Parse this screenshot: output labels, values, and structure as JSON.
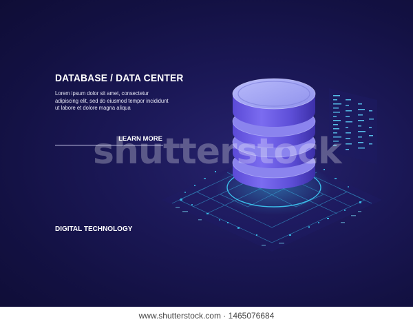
{
  "banner": {
    "headline": "DATABASE / DATA CENTER",
    "body": "Lorem ipsum dolor sit amet, consectetur adipiscing elit, sed do eiusmod tempor incididunt ut labore et dolore magna aliqua",
    "cta_label": "LEARN MORE",
    "footer_tag": "DIGITAL TECHNOLOGY",
    "watermark": "shutterstock"
  },
  "credit": {
    "text": "www.shutterstock.com · 1465076684"
  },
  "colors": {
    "background": "#1b1857",
    "accent_cyan": "#3fd6ff",
    "disk_top": "#a7a9f4",
    "disk_side": "#6f5fe0",
    "disk_rim": "#5a4ad1"
  },
  "icons": {
    "database": "database-stack-icon",
    "circuit": "circuit-board-icon",
    "data_panel": "data-stream-panel-icon"
  }
}
